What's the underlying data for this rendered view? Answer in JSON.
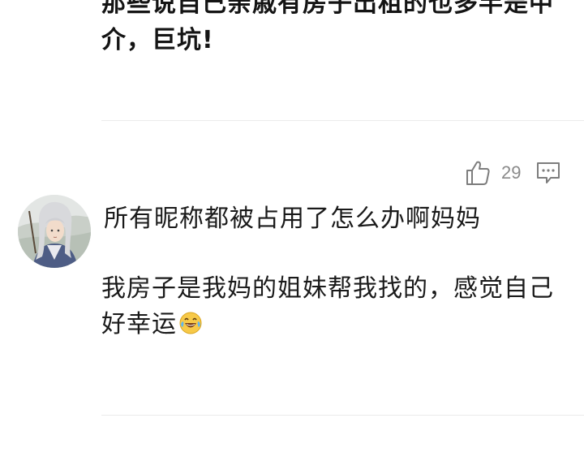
{
  "previous_comment": {
    "text": "那些说自己亲戚有房子出租的也多半是中介，巨坑!"
  },
  "actions": {
    "like_count": "29",
    "like_icon": "thumbs-up-icon",
    "comment_icon": "comment-icon"
  },
  "comment": {
    "username": "所有昵称都被占用了怎么办啊妈妈",
    "body": "我房子是我妈的姐妹帮我找的，感觉自己好幸运",
    "emoji": "laughing-tears-emoji"
  },
  "colors": {
    "text": "#1a1a1a",
    "muted": "#8a8a8a",
    "divider": "#ebebeb"
  }
}
